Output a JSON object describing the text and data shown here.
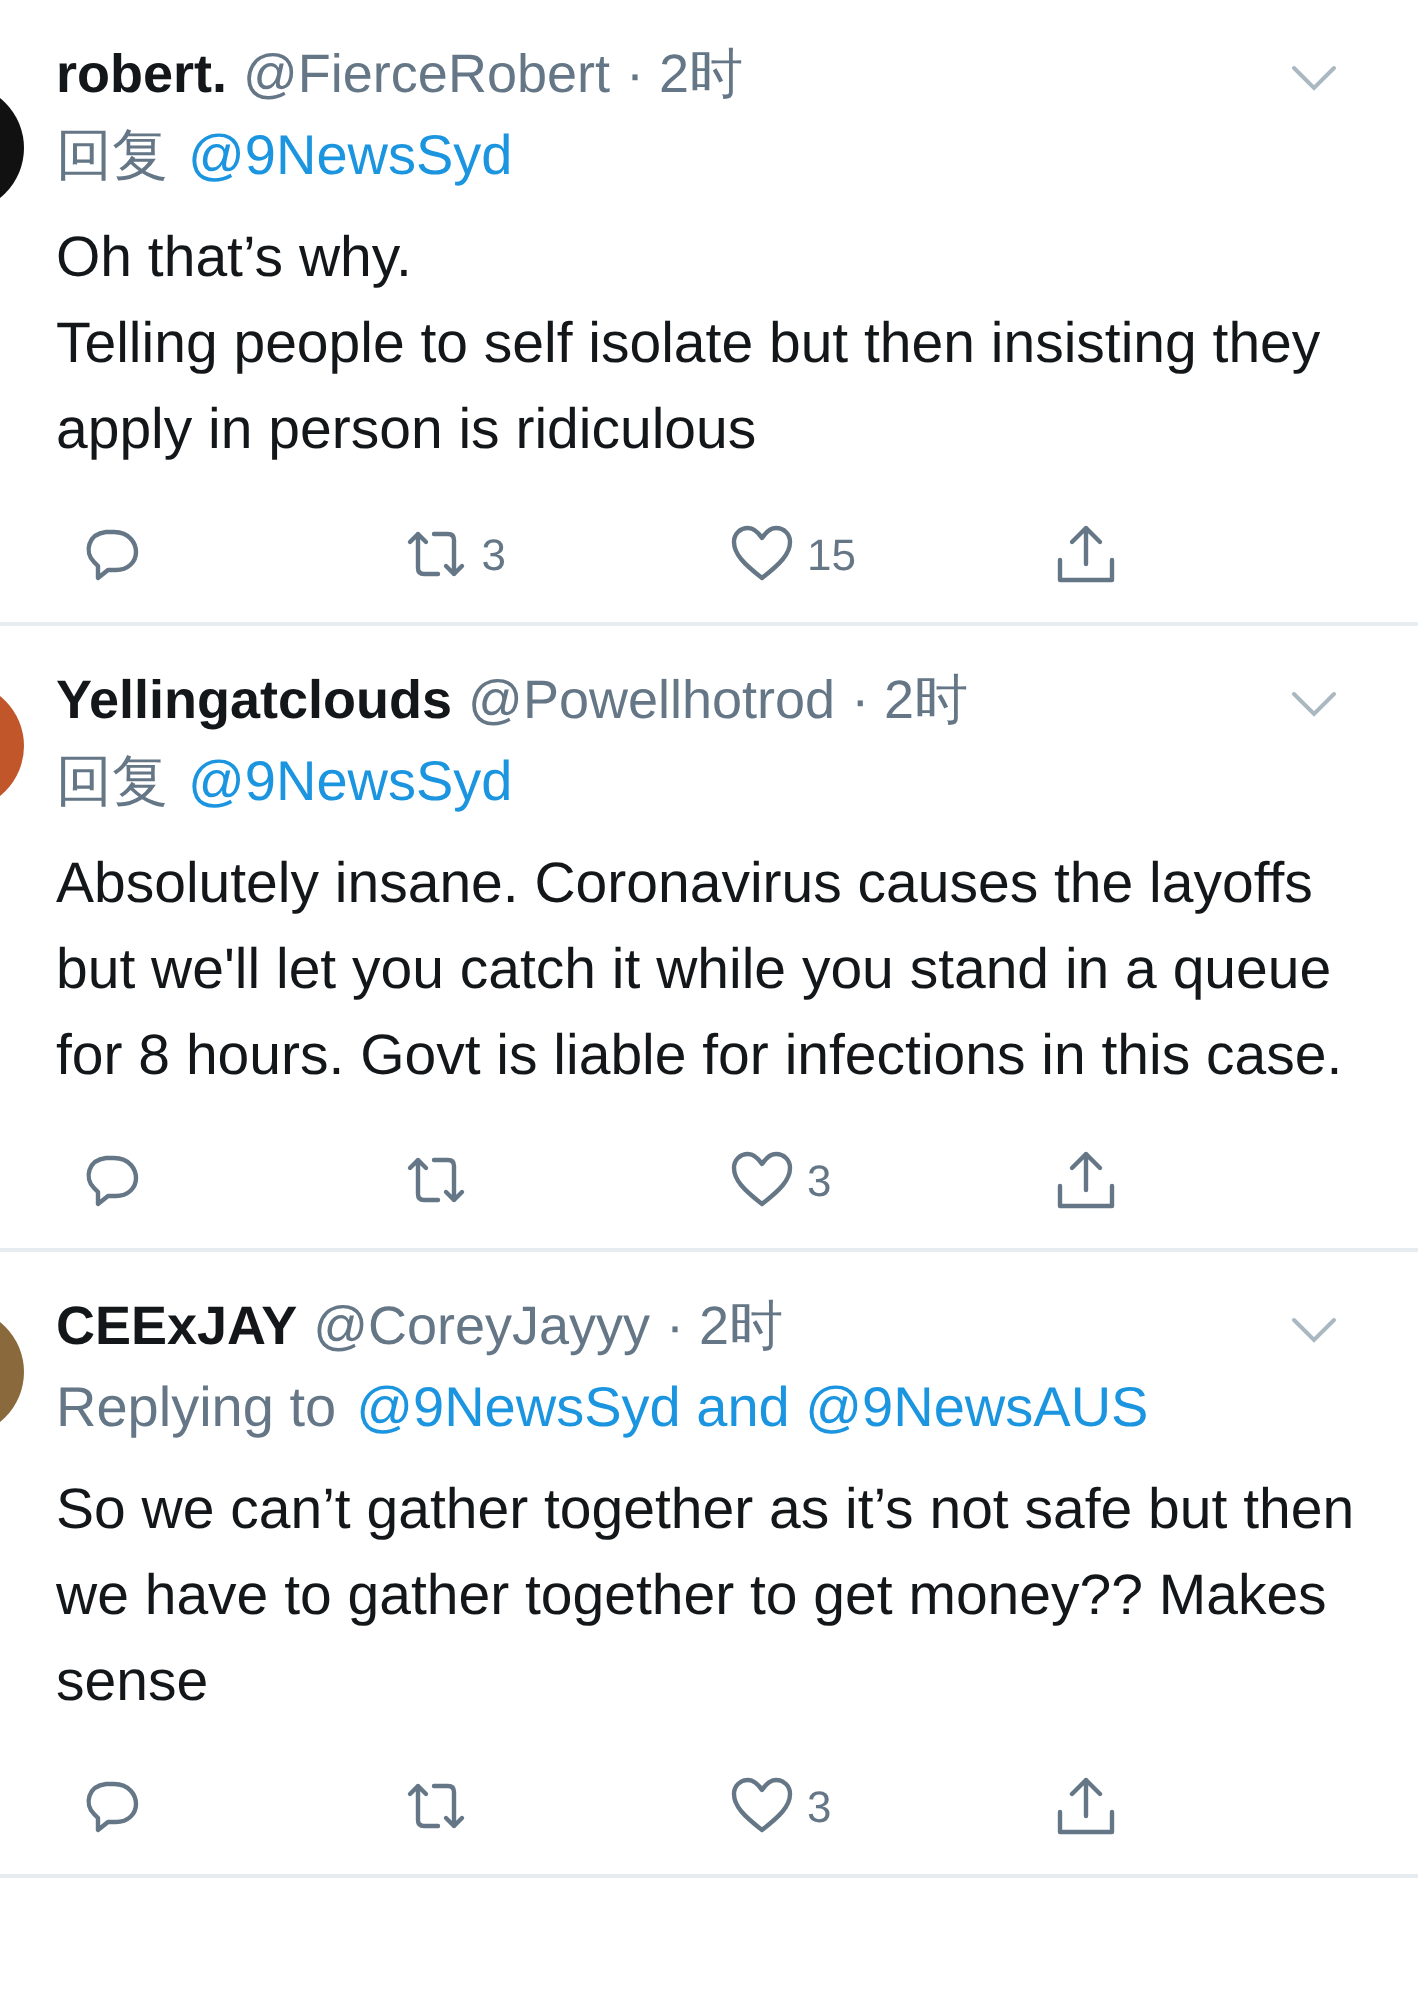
{
  "tweets": [
    {
      "name": "robert.",
      "handle": "@FierceRobert",
      "time": "· 2时",
      "reply_label": "回复",
      "reply_to": "@9NewsSyd",
      "text": "Oh that’s why.\nTelling people to self isolate but then insisting they apply in person is ridiculous",
      "retweets": "3",
      "likes": "15"
    },
    {
      "name": "Yellingatclouds",
      "handle": "@Powellhotrod",
      "time": "· 2时",
      "reply_label": "回复",
      "reply_to": "@9NewsSyd",
      "text": "Absolutely insane. Coronavirus causes the layoffs but we'll let you catch it while you stand in a queue for 8 hours. Govt is liable for infections in this case.",
      "likes": "3"
    },
    {
      "name": "CEExJAY",
      "handle": "@CoreyJayyy",
      "time": "· 2时",
      "reply_label": "Replying to",
      "reply_to": "@9NewsSyd and @9NewsAUS",
      "text": "So we can’t gather together as it’s not safe but then we have to gather together to get money?? Makes sense",
      "likes": "3"
    }
  ]
}
